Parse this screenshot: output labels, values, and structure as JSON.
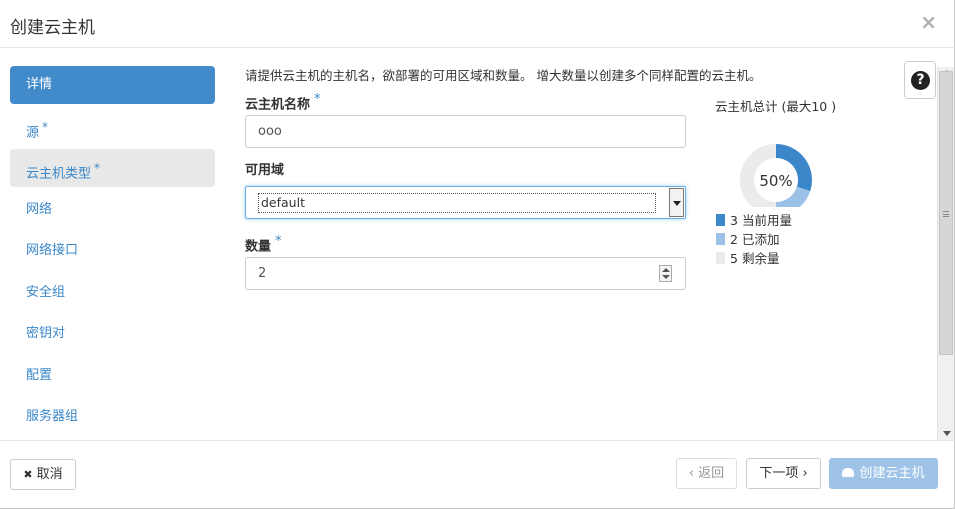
{
  "title": "创建云主机",
  "close_glyph": "×",
  "nav": [
    {
      "label": "详情",
      "required": false
    },
    {
      "label": "源",
      "required": true
    },
    {
      "label": "云主机类型",
      "required": true
    },
    {
      "label": "网络",
      "required": false
    },
    {
      "label": "网络接口",
      "required": false
    },
    {
      "label": "安全组",
      "required": false
    },
    {
      "label": "密钥对",
      "required": false
    },
    {
      "label": "配置",
      "required": false
    },
    {
      "label": "服务器组",
      "required": false
    }
  ],
  "required_mark": "*",
  "help_text": "请提供云主机的主机名，欲部署的可用区域和数量。 增大数量以创建多个同样配置的云主机。",
  "form": {
    "name_label": "云主机名称",
    "name_value": "ooo",
    "zone_label": "可用域",
    "zone_value": "default",
    "count_label": "数量",
    "count_value": "2"
  },
  "chart_data": {
    "type": "pie",
    "title": "云主机总计 (最大10 )",
    "center_label": "50%",
    "max": 10,
    "slices": [
      {
        "label": "当前用量",
        "value": 3,
        "color": "#3b87c9"
      },
      {
        "label": "已添加",
        "value": 2,
        "color": "#9bc2e6"
      },
      {
        "label": "剩余量",
        "value": 5,
        "color": "#ebebeb"
      }
    ]
  },
  "help_icon": "?",
  "footer": {
    "cancel_label": "取消",
    "cancel_icon": "✖",
    "back_label": "‹ 返回",
    "next_label": "下一项 ›",
    "launch_label": "创建云主机"
  }
}
